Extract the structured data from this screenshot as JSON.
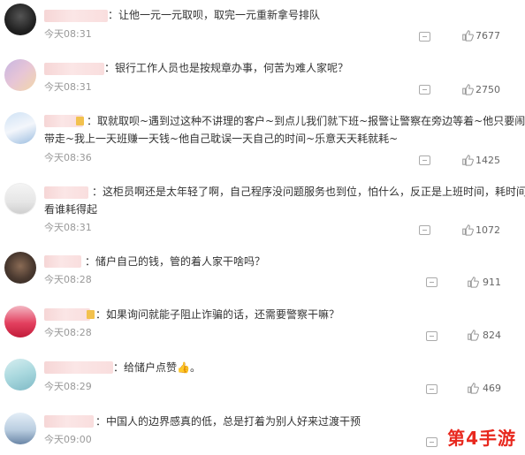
{
  "comments": [
    {
      "text": "：让他一元一元取呗，取完一元重新拿号排队",
      "time": "今天08:31",
      "likes": "7677"
    },
    {
      "text": "：银行工作人员也是按规章办事，何苦为难人家呢？",
      "time": "今天08:31",
      "likes": "2750"
    },
    {
      "text": "：取就取呗~遇到过这种不讲理的客户~到点儿我们就下班~报警让警察在旁边等着~他只要闹就",
      "text2": "带走~我上一天班赚一天钱~他自己耽误一天自己的时间~乐意天天耗就耗~",
      "time": "今天08:36",
      "likes": "1425"
    },
    {
      "text": "：这柜员啊还是太年轻了啊，自己程序没问题服务也到位，怕什么，反正是上班时间，耗时间",
      "text2": "看谁耗得起",
      "time": "今天08:31",
      "likes": "1072"
    },
    {
      "text": "：储户自己的钱，管的着人家干啥吗？",
      "time": "今天08:28",
      "likes": "911"
    },
    {
      "text": "：如果询问就能子阻止诈骗的话，还需要警察干嘛？",
      "time": "今天08:28",
      "likes": "824"
    },
    {
      "text": "：给储户点赞👍。",
      "time": "今天08:29",
      "likes": "469"
    },
    {
      "text": "：中国人的边界感真的低，总是打着为别人好来过渡干预",
      "time": "今天09:00",
      "likes": ""
    }
  ],
  "watermark": "第4手游",
  "icons": {
    "reply": "comment-icon",
    "like": "thumbs-up-icon"
  },
  "colors": {
    "watermark": "#e8281e",
    "username_blur": "#f6d6d6",
    "badge": "#f2c14e"
  }
}
